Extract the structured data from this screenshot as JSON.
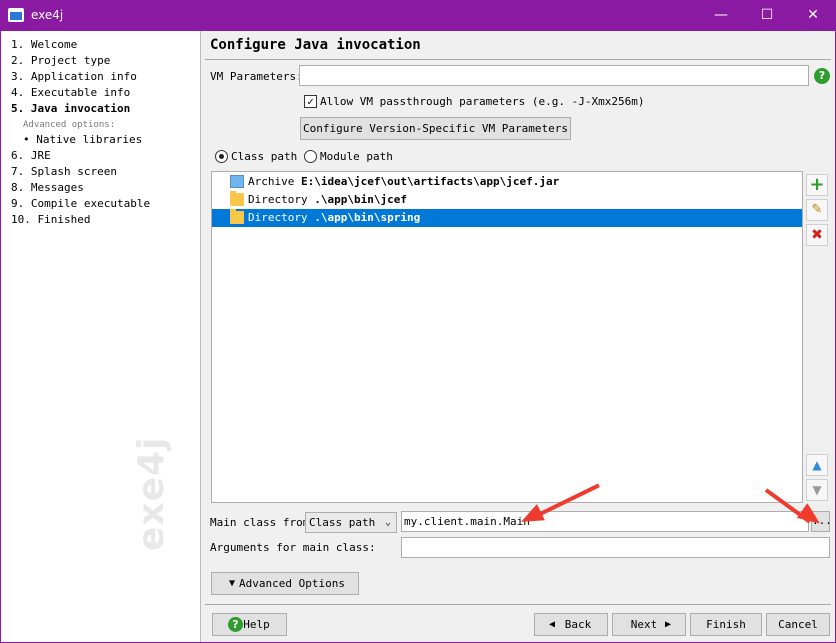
{
  "window": {
    "title": "exe4j",
    "minimize": "—",
    "maximize": "☐",
    "close": "✕"
  },
  "sidebar": {
    "steps": [
      {
        "label": "1.  Welcome"
      },
      {
        "label": "2.  Project type"
      },
      {
        "label": "3.  Application info"
      },
      {
        "label": "4.  Executable info"
      },
      {
        "label": "5.  Java invocation"
      },
      {
        "label": "Advanced options:"
      },
      {
        "label": "• Native libraries"
      },
      {
        "label": "6.  JRE"
      },
      {
        "label": "7.  Splash screen"
      },
      {
        "label": "8.  Messages"
      },
      {
        "label": "9.  Compile executable"
      },
      {
        "label": "10.  Finished"
      }
    ],
    "watermark": "exe4j"
  },
  "page": {
    "title": "Configure Java invocation"
  },
  "vm": {
    "label": "VM Parameters:",
    "value": "",
    "passthrough_label": "Allow VM passthrough parameters (e.g. -J-Xmx256m)",
    "passthrough_checked": "✓",
    "version_button": "Configure Version-Specific VM Parameters"
  },
  "path_mode": {
    "class_path": "Class path",
    "module_path": "Module path",
    "selected": "class_path"
  },
  "entries": [
    {
      "type": "Archive",
      "path": "E:\\idea\\jcef\\out\\artifacts\\app\\jcef.jar",
      "icon": "jar-icon",
      "selected": false
    },
    {
      "type": "Directory",
      "path": ".\\app\\bin\\jcef",
      "icon": "folder-icon",
      "selected": false
    },
    {
      "type": "Directory",
      "path": ".\\app\\bin\\spring",
      "icon": "folder-icon",
      "selected": true
    }
  ],
  "list_buttons": {
    "add": "+",
    "edit": "✎",
    "remove": "✖",
    "up": "▲",
    "down": "▼"
  },
  "main_class": {
    "label": "Main class from",
    "source": "Class path",
    "value": "my.client.main.Main",
    "browse": "..."
  },
  "arguments": {
    "label": "Arguments for main class:",
    "value": ""
  },
  "advanced_button": "Advanced Options",
  "footer": {
    "help": "Help",
    "back": "Back",
    "next": "Next",
    "finish": "Finish",
    "cancel": "Cancel"
  },
  "colors": {
    "titlebar": "#8b1aa3",
    "selection": "#0078d7",
    "annotation_arrow": "#f03a2e"
  }
}
